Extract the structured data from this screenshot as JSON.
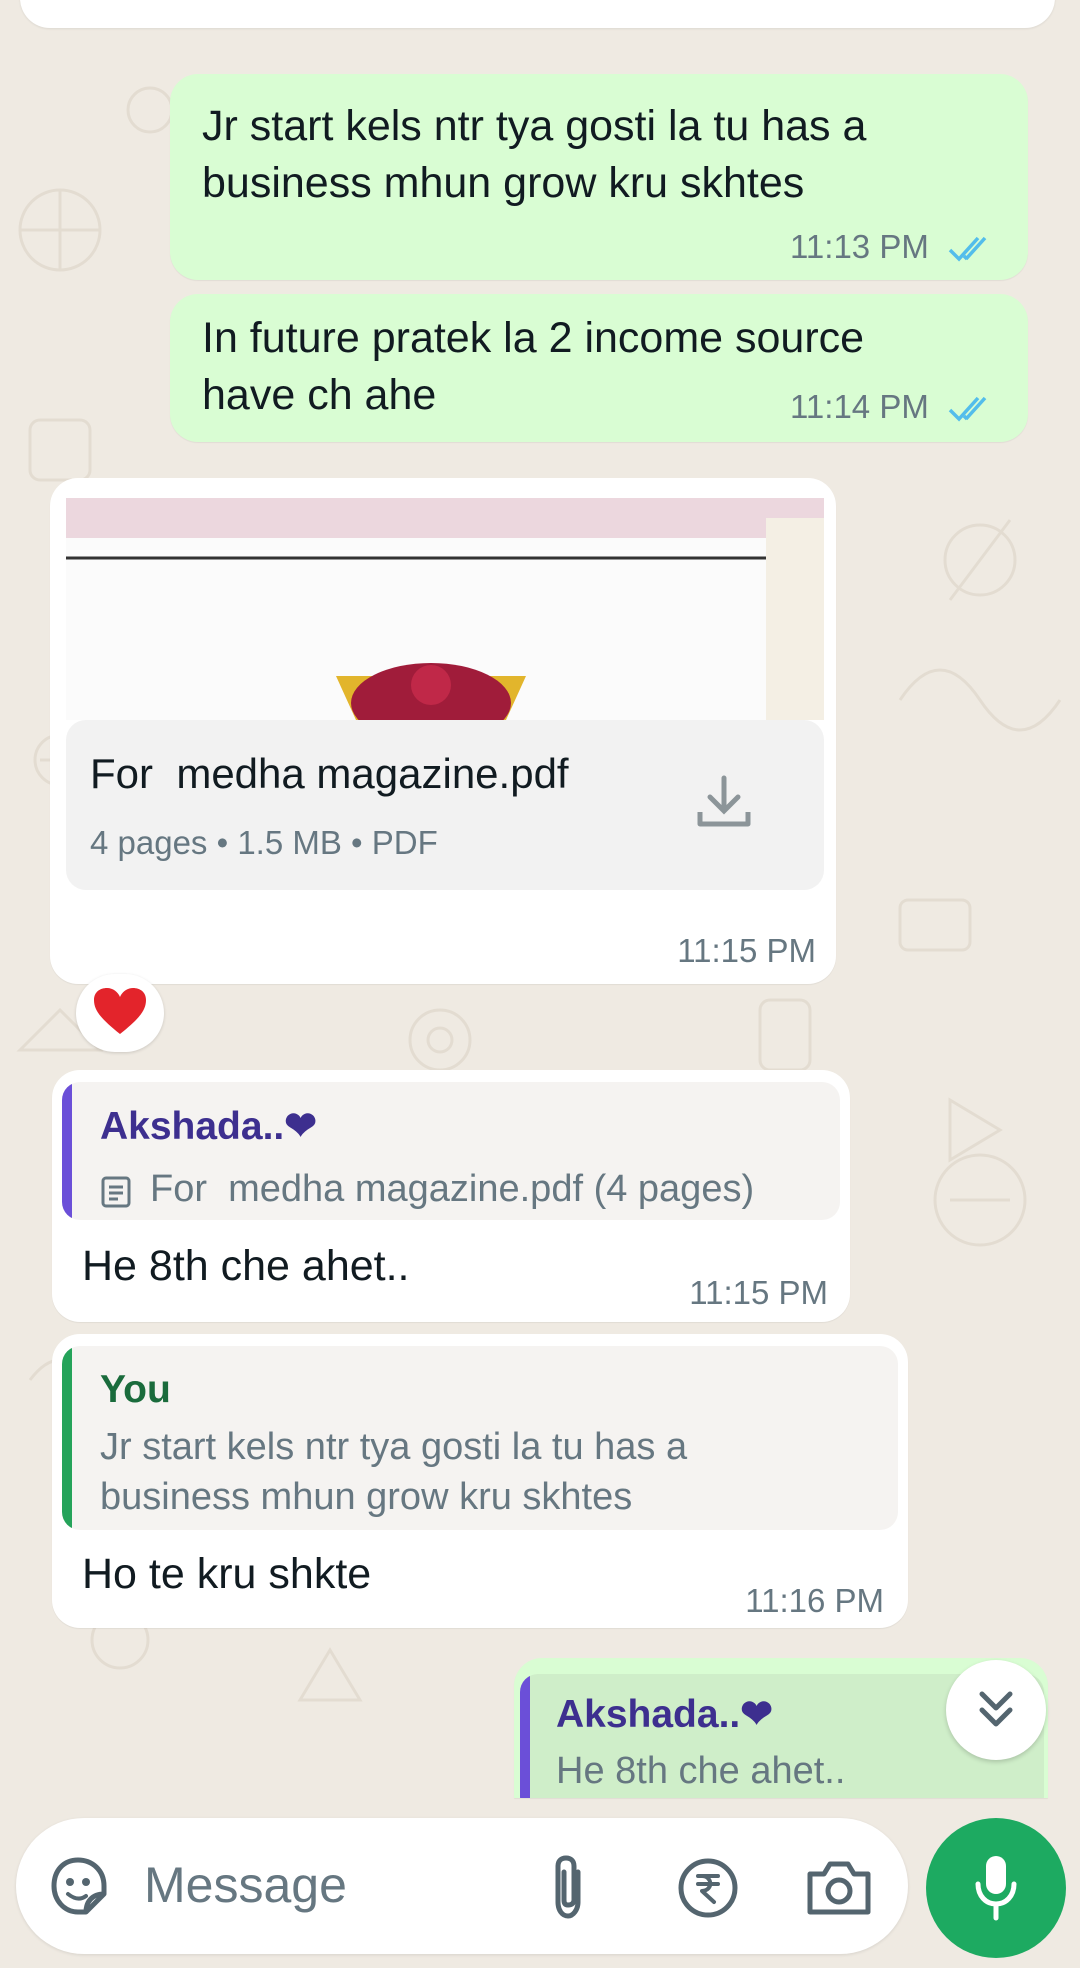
{
  "colors": {
    "outgoing_bubble": "#d9fdd3",
    "incoming_bubble": "#ffffff",
    "read_ticks": "#53bdeb",
    "accent_green": "#1daa61",
    "quote_bar_contact": "#6b4fd8",
    "quote_bar_self": "#25a35a"
  },
  "messages": [
    {
      "direction": "outgoing",
      "text_line1": "Jr start kels ntr tya gosti la tu has a",
      "text_line2": "business mhun grow kru skhtes",
      "time": "11:13 PM",
      "status": "read"
    },
    {
      "direction": "outgoing",
      "text_line1": "In future pratek la 2 income source",
      "text_line2": "have ch ahe",
      "time": "11:14 PM",
      "status": "read"
    },
    {
      "direction": "incoming",
      "type": "document",
      "file_name": "For  medha magazine.pdf",
      "file_meta": "4 pages • 1.5 MB • PDF",
      "time": "11:15 PM",
      "reaction": "❤️",
      "download_icon": "download-icon"
    },
    {
      "direction": "incoming",
      "quote_author": "Akshada..❤",
      "quote_text": "For  medha magazine.pdf (4 pages)",
      "quote_icon": "document-icon",
      "text": "He 8th che ahet..",
      "time": "11:15 PM"
    },
    {
      "direction": "incoming",
      "quote_author": "You",
      "quote_text_line1": "Jr start kels ntr tya gosti la tu has a",
      "quote_text_line2": "business mhun grow kru skhtes",
      "text": "Ho te kru shkte",
      "time": "11:16 PM"
    },
    {
      "direction": "outgoing",
      "quote_author": "Akshada..❤",
      "quote_text": "He 8th che ahet.."
    }
  ],
  "composer": {
    "placeholder": "Message",
    "icons": [
      "sticker-icon",
      "attach-icon",
      "rupee-payment-icon",
      "camera-icon",
      "mic-icon"
    ]
  },
  "scroll_button_icon": "double-chevron-down-icon"
}
